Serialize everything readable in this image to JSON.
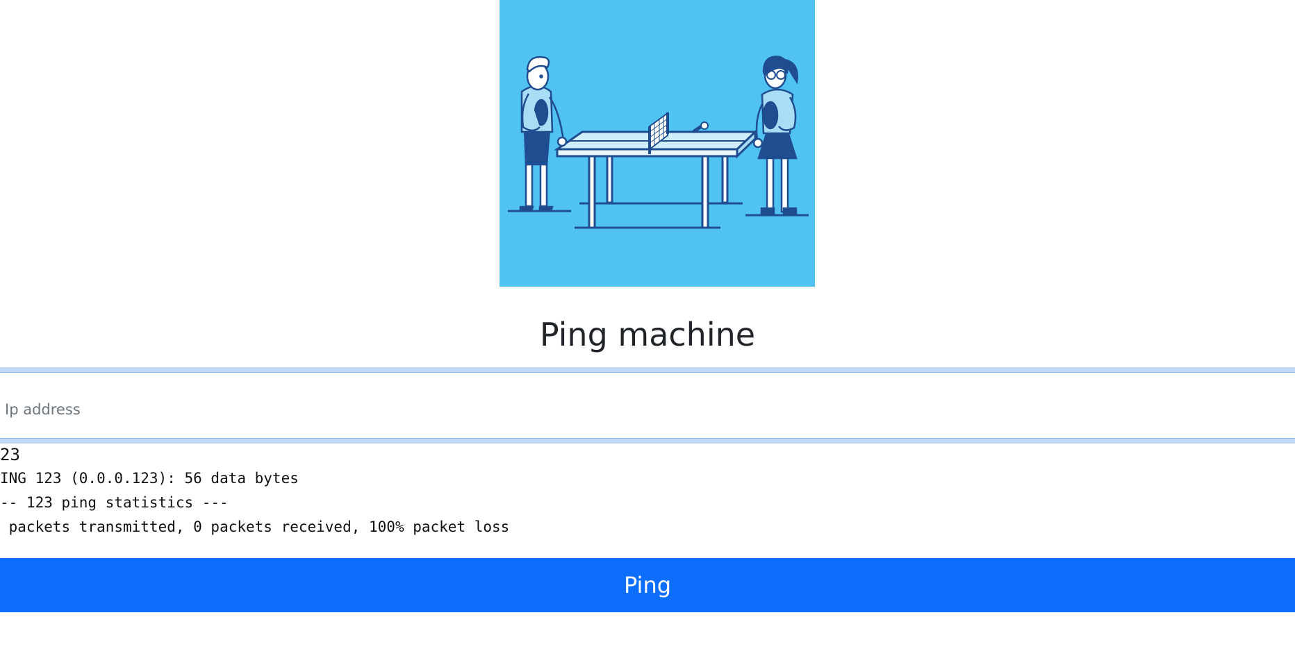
{
  "page": {
    "title": "Ping machine"
  },
  "form": {
    "ip_placeholder": "Ip address",
    "ip_value": "",
    "submit_label": "Ping"
  },
  "output": {
    "first_line": "23",
    "lines": [
      "ING 123 (0.0.0.123): 56 data bytes",
      "-- 123 ping statistics ---",
      " packets transmitted, 0 packets received, 100% packet loss"
    ]
  },
  "colors": {
    "hero_background": "#50c3f3",
    "button_primary": "#0d6efd",
    "input_focus_ring": "#c2d9f6"
  }
}
